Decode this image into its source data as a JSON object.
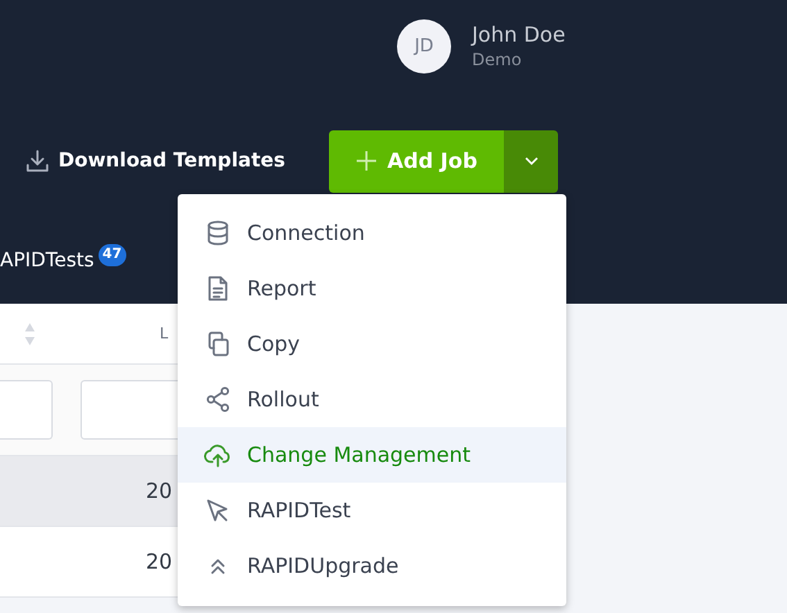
{
  "user": {
    "initials": "JD",
    "name": "John Doe",
    "role": "Demo"
  },
  "toolbar": {
    "download_label": "Download Templates",
    "add_label": "Add Job"
  },
  "tab": {
    "label": "APIDTests",
    "count": "47"
  },
  "table": {
    "columns": [
      {
        "sortable": true
      },
      {
        "label": "L",
        "sortable": false
      }
    ],
    "rows": [
      {
        "cells": [
          "",
          "20"
        ],
        "selected": true
      },
      {
        "cells": [
          "",
          "20"
        ],
        "selected": false
      }
    ]
  },
  "menu": {
    "items": [
      {
        "label": "Connection",
        "kind": "database",
        "selected": false
      },
      {
        "label": "Report",
        "kind": "document",
        "selected": false
      },
      {
        "label": "Copy",
        "kind": "copy",
        "selected": false
      },
      {
        "label": "Rollout",
        "kind": "share",
        "selected": false
      },
      {
        "label": "Change Management",
        "kind": "upload",
        "selected": true
      },
      {
        "label": "RAPIDTest",
        "kind": "pointer",
        "selected": false
      },
      {
        "label": "RAPIDUpgrade",
        "kind": "chevrons",
        "selected": false
      }
    ]
  }
}
